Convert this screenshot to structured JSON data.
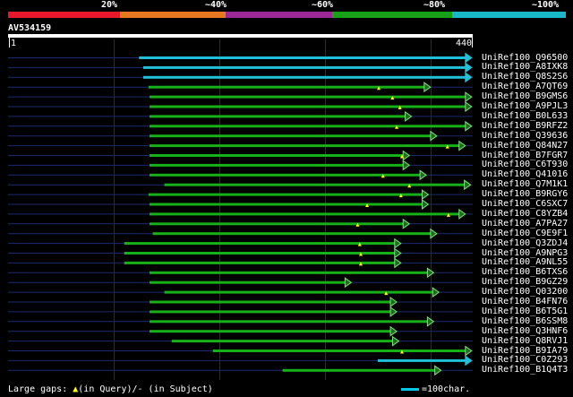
{
  "identity_scale": [
    {
      "label": "20%",
      "color": "#e8182c"
    },
    {
      "label": "~40%",
      "color": "#e87820"
    },
    {
      "label": "~60%",
      "color": "#9c2898"
    },
    {
      "label": "~80%",
      "color": "#18a018"
    },
    {
      "label": "~100%",
      "color": "#18b8c8"
    }
  ],
  "query": {
    "name": "AV534159",
    "start": "1",
    "end": "440",
    "length": 440
  },
  "hits": [
    {
      "name": "UniRef100_Q96500",
      "start": 124,
      "end": 439,
      "color": "#20c0d8",
      "gaps": []
    },
    {
      "name": "UniRef100_A8IXK8",
      "start": 128,
      "end": 439,
      "color": "#20c0d8",
      "gaps": []
    },
    {
      "name": "UniRef100_Q8S2S6",
      "start": 128,
      "end": 439,
      "color": "#20c0d8",
      "gaps": []
    },
    {
      "name": "UniRef100_A7QT69",
      "start": 133,
      "end": 400,
      "color": "#18b018",
      "gaps": [
        351
      ]
    },
    {
      "name": "UniRef100_B9GMS6",
      "start": 134,
      "end": 439,
      "color": "#18b018",
      "gaps": [
        364
      ]
    },
    {
      "name": "UniRef100_A9PJL3",
      "start": 134,
      "end": 439,
      "color": "#18b018",
      "gaps": [
        371
      ]
    },
    {
      "name": "UniRef100_B0L633",
      "start": 134,
      "end": 382,
      "color": "#18b018",
      "gaps": []
    },
    {
      "name": "UniRef100_B9RFZ2",
      "start": 134,
      "end": 439,
      "color": "#18b018",
      "gaps": [
        368
      ]
    },
    {
      "name": "UniRef100_Q39636",
      "start": 134,
      "end": 406,
      "color": "#18b018",
      "gaps": []
    },
    {
      "name": "UniRef100_Q84N27",
      "start": 134,
      "end": 433,
      "color": "#18b018",
      "gaps": [
        416
      ]
    },
    {
      "name": "UniRef100_B7FGR7",
      "start": 134,
      "end": 380,
      "color": "#18b018",
      "gaps": [
        373
      ]
    },
    {
      "name": "UniRef100_C6T930",
      "start": 134,
      "end": 380,
      "color": "#18b018",
      "gaps": []
    },
    {
      "name": "UniRef100_Q41016",
      "start": 134,
      "end": 396,
      "color": "#18b018",
      "gaps": [
        355
      ]
    },
    {
      "name": "UniRef100_Q7M1K1",
      "start": 148,
      "end": 438,
      "color": "#18b018",
      "gaps": [
        380
      ]
    },
    {
      "name": "UniRef100_B9RGY6",
      "start": 133,
      "end": 398,
      "color": "#18b018",
      "gaps": [
        372
      ]
    },
    {
      "name": "UniRef100_C6SXC7",
      "start": 134,
      "end": 398,
      "color": "#18b018",
      "gaps": [
        340
      ]
    },
    {
      "name": "UniRef100_C8YZB4",
      "start": 134,
      "end": 433,
      "color": "#18b018",
      "gaps": [
        417
      ]
    },
    {
      "name": "UniRef100_A7PA27",
      "start": 134,
      "end": 380,
      "color": "#18b018",
      "gaps": [
        331
      ]
    },
    {
      "name": "UniRef100_C9E9F1",
      "start": 137,
      "end": 406,
      "color": "#18b018",
      "gaps": []
    },
    {
      "name": "UniRef100_Q3ZDJ4",
      "start": 110,
      "end": 372,
      "color": "#18b018",
      "gaps": [
        333
      ]
    },
    {
      "name": "UniRef100_A9NPG3",
      "start": 110,
      "end": 372,
      "color": "#18b018",
      "gaps": [
        334
      ]
    },
    {
      "name": "UniRef100_A9NL55",
      "start": 110,
      "end": 372,
      "color": "#18b018",
      "gaps": [
        334
      ]
    },
    {
      "name": "UniRef100_B6TXS6",
      "start": 134,
      "end": 403,
      "color": "#18b018",
      "gaps": []
    },
    {
      "name": "UniRef100_B9GZ29",
      "start": 134,
      "end": 325,
      "color": "#18b018",
      "gaps": []
    },
    {
      "name": "UniRef100_Q03200",
      "start": 148,
      "end": 408,
      "color": "#18b018",
      "gaps": [
        358
      ]
    },
    {
      "name": "UniRef100_B4FN76",
      "start": 134,
      "end": 368,
      "color": "#18b018",
      "gaps": []
    },
    {
      "name": "UniRef100_B6T5G1",
      "start": 134,
      "end": 368,
      "color": "#18b018",
      "gaps": []
    },
    {
      "name": "UniRef100_B6SSM8",
      "start": 134,
      "end": 403,
      "color": "#18b018",
      "gaps": []
    },
    {
      "name": "UniRef100_Q3HNF6",
      "start": 134,
      "end": 368,
      "color": "#18b018",
      "gaps": []
    },
    {
      "name": "UniRef100_Q8RVJ1",
      "start": 155,
      "end": 370,
      "color": "#18b018",
      "gaps": []
    },
    {
      "name": "UniRef100_B9IA79",
      "start": 194,
      "end": 439,
      "color": "#18b018",
      "gaps": [
        373
      ]
    },
    {
      "name": "UniRef100_C0Z293",
      "start": 350,
      "end": 439,
      "color": "#20c0d8",
      "gaps": []
    },
    {
      "name": "UniRef100_B1Q4T3",
      "start": 260,
      "end": 410,
      "color": "#18b018",
      "gaps": []
    }
  ],
  "footer": {
    "gaps_prefix": "Large gaps: ",
    "gap_symbol": "▲",
    "gaps_suffix": "(in Query)/- (in Subject)",
    "scale_label": "=100char."
  }
}
